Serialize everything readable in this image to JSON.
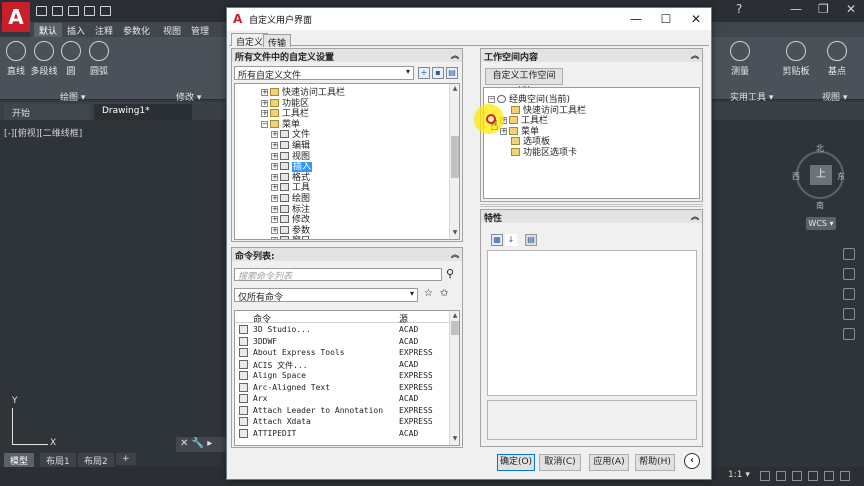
{
  "app": {
    "logo_letter": "A",
    "ribbon_tabs": [
      "默认",
      "插入",
      "注释",
      "参数化",
      "视图",
      "管理"
    ],
    "ribbon_tools": [
      "直线",
      "多段线",
      "圆",
      "圆弧",
      "测量",
      "剪贴板",
      "基点"
    ],
    "panel_titles": [
      "绘图 ▾",
      "修改 ▾",
      "实用工具 ▾",
      "视图 ▾"
    ],
    "doc_tabs": [
      "开始",
      "Drawing1*"
    ],
    "viewport_label": "[-][俯视][二维线框]",
    "viewcube": {
      "face": "上",
      "north": "北",
      "south": "南",
      "east": "东",
      "west": "西"
    },
    "wcs_label": "WCS ▾",
    "ucs": {
      "x": "X",
      "y": "Y"
    },
    "layout_tabs": [
      "模型",
      "布局1",
      "布局2",
      "+"
    ],
    "status_items": [
      "1:1 ▾"
    ]
  },
  "dialog": {
    "logo": "A",
    "title": "自定义用户界面",
    "controls": {
      "minimize": "—",
      "maximize": "☐",
      "close": "✕"
    },
    "tabs": [
      "自定义",
      "传输"
    ],
    "left_top": {
      "header": "所有文件中的自定义设置",
      "filter": "所有自定义文件",
      "tree": [
        {
          "label": "快速访问工具栏",
          "level": 1,
          "expand": "+"
        },
        {
          "label": "功能区",
          "level": 1,
          "expand": "+"
        },
        {
          "label": "工具栏",
          "level": 1,
          "expand": "+"
        },
        {
          "label": "菜单",
          "level": 1,
          "expand": "−"
        },
        {
          "label": "文件",
          "level": 2,
          "expand": "+"
        },
        {
          "label": "编辑",
          "level": 2,
          "expand": "+"
        },
        {
          "label": "视图",
          "level": 2,
          "expand": "+"
        },
        {
          "label": "插入",
          "level": 2,
          "expand": "+",
          "selected": true
        },
        {
          "label": "格式",
          "level": 2,
          "expand": "+"
        },
        {
          "label": "工具",
          "level": 2,
          "expand": "+"
        },
        {
          "label": "绘图",
          "level": 2,
          "expand": "+"
        },
        {
          "label": "标注",
          "level": 2,
          "expand": "+"
        },
        {
          "label": "修改",
          "level": 2,
          "expand": "+"
        },
        {
          "label": "参数",
          "level": 2,
          "expand": "+"
        },
        {
          "label": "窗口",
          "level": 2,
          "expand": "+"
        }
      ]
    },
    "left_bottom": {
      "header": "命令列表:",
      "search_placeholder": "搜索命令列表",
      "filter": "仅所有命令",
      "col_command": "命令",
      "col_source": "源",
      "commands": [
        {
          "name": "3D Studio...",
          "source": "ACAD"
        },
        {
          "name": "3DDWF",
          "source": "ACAD"
        },
        {
          "name": "About Express Tools",
          "source": "EXPRESS"
        },
        {
          "name": "ACIS 文件...",
          "source": "ACAD"
        },
        {
          "name": "Align Space",
          "source": "EXPRESS"
        },
        {
          "name": "Arc-Aligned Text",
          "source": "EXPRESS"
        },
        {
          "name": "Arx",
          "source": "ACAD"
        },
        {
          "name": "Attach Leader to Annotation",
          "source": "EXPRESS"
        },
        {
          "name": "Attach Xdata",
          "source": "EXPRESS"
        },
        {
          "name": "ATTIPEDIT",
          "source": "ACAD"
        }
      ]
    },
    "right_top": {
      "header": "工作空间内容",
      "button": "自定义工作空间(C)",
      "tree": [
        {
          "label": "经典空间(当前)",
          "level": 0,
          "expand": "−",
          "icon": "gear"
        },
        {
          "label": "快速访问工具栏",
          "level": 1,
          "expand": ""
        },
        {
          "label": "工具栏",
          "level": 1,
          "expand": "+"
        },
        {
          "label": "菜单",
          "level": 1,
          "expand": "+"
        },
        {
          "label": "选项板",
          "level": 1,
          "expand": ""
        },
        {
          "label": "功能区选项卡",
          "level": 1,
          "expand": ""
        }
      ]
    },
    "right_bottom": {
      "header": "特性"
    },
    "buttons": {
      "ok": "确定(O)",
      "cancel": "取消(C)",
      "apply": "应用(A)",
      "help": "帮助(H)",
      "toggle": "‹"
    }
  }
}
